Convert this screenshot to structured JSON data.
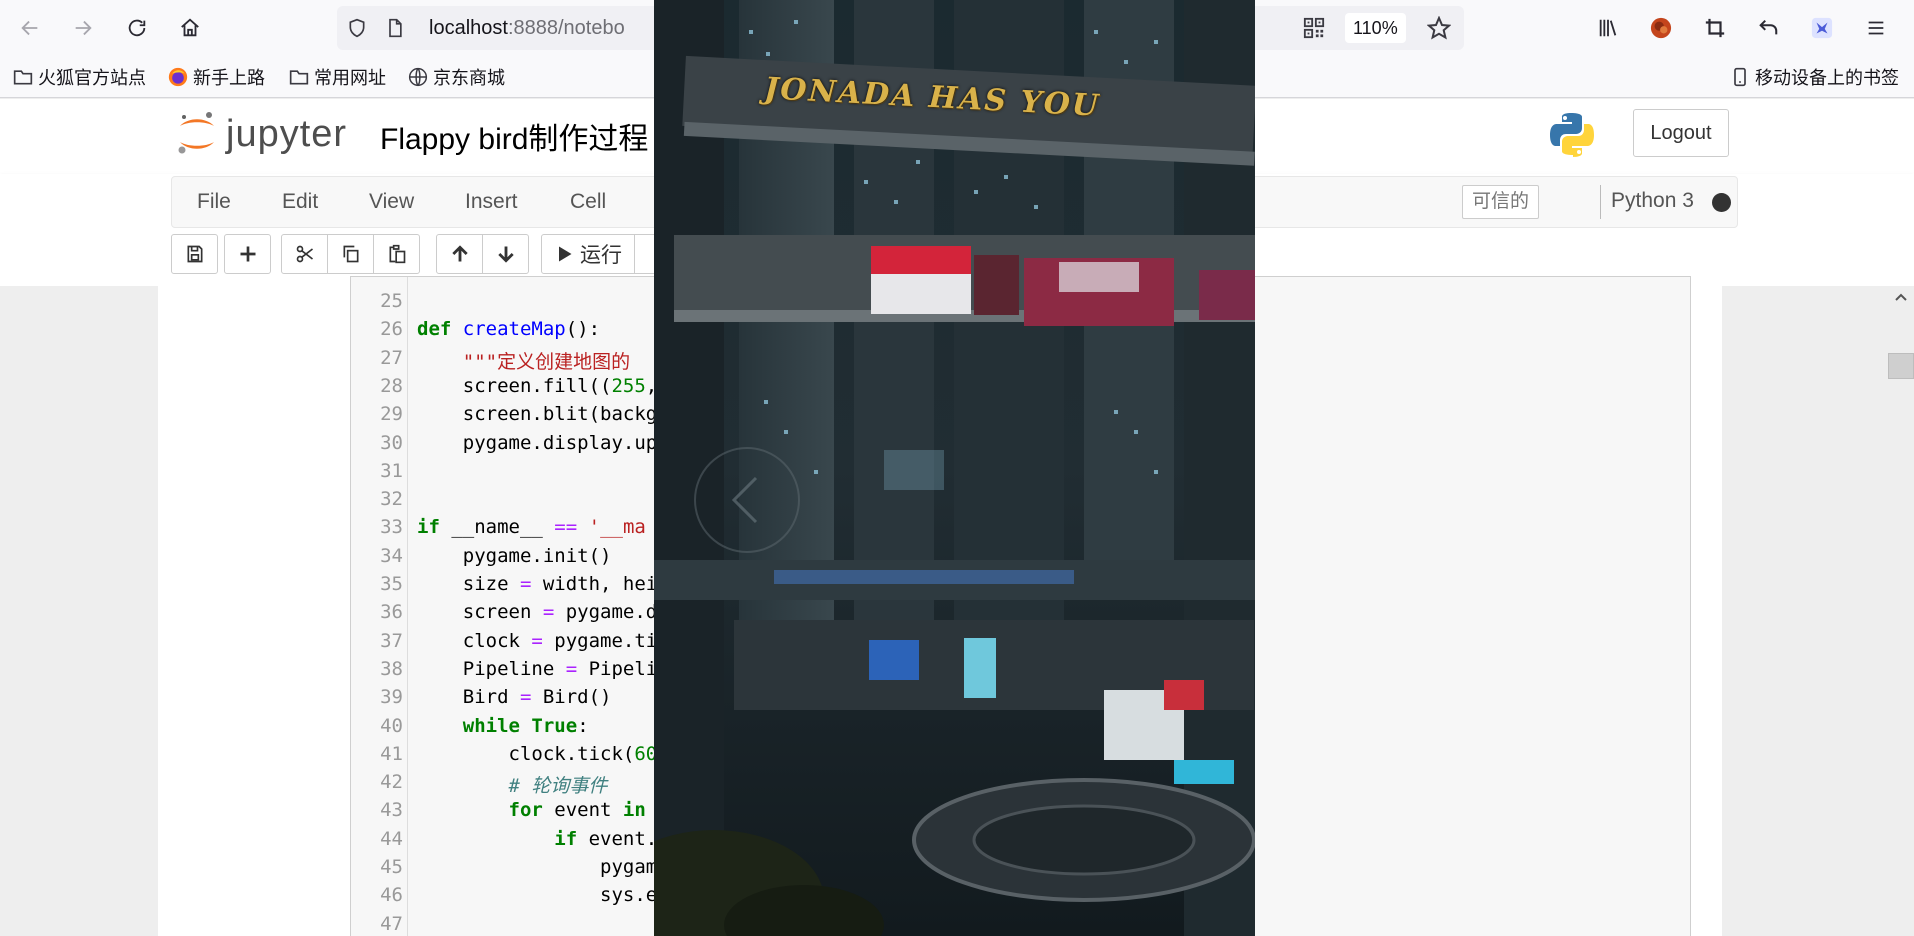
{
  "browser": {
    "url_host": "localhost",
    "url_path": ":8888/notebo",
    "zoom": "110%",
    "bookmarks": [
      {
        "label": "火狐官方站点",
        "icon": "folder-icon"
      },
      {
        "label": "新手上路",
        "icon": "firefox-icon"
      },
      {
        "label": "常用网址",
        "icon": "folder-icon"
      },
      {
        "label": "京东商城",
        "icon": "globe-icon"
      }
    ],
    "mobile_bookmarks": "移动设备上的书签"
  },
  "jupyter": {
    "logo_text": "jupyter",
    "notebook_title": "Flappy bird制作过程",
    "logout_label": "Logout",
    "menu": [
      "File",
      "Edit",
      "View",
      "Insert",
      "Cell"
    ],
    "trusted_label": "可信的",
    "kernel_name": "Python 3",
    "run_label": "运行"
  },
  "code_lines": [
    {
      "n": "25",
      "tokens": []
    },
    {
      "n": "26",
      "tokens": [
        {
          "t": "def",
          "c": "kw"
        },
        {
          "t": " "
        },
        {
          "t": "createMap",
          "c": "fn"
        },
        {
          "t": "():"
        }
      ]
    },
    {
      "n": "27",
      "tokens": [
        {
          "t": "    "
        },
        {
          "t": "\"\"\"定义创建地图的",
          "c": "str"
        }
      ]
    },
    {
      "n": "28",
      "tokens": [
        {
          "t": "    screen.fill(("
        },
        {
          "t": "255",
          "c": "num"
        },
        {
          "t": ","
        }
      ]
    },
    {
      "n": "29",
      "tokens": [
        {
          "t": "    screen.blit(backg"
        }
      ]
    },
    {
      "n": "30",
      "tokens": [
        {
          "t": "    pygame.display.up"
        }
      ]
    },
    {
      "n": "31",
      "tokens": []
    },
    {
      "n": "32",
      "tokens": []
    },
    {
      "n": "33",
      "tokens": [
        {
          "t": "if",
          "c": "kw"
        },
        {
          "t": " __name__ "
        },
        {
          "t": "==",
          "c": "op"
        },
        {
          "t": " "
        },
        {
          "t": "'__ma",
          "c": "str"
        }
      ]
    },
    {
      "n": "34",
      "tokens": [
        {
          "t": "    pygame.init()"
        }
      ]
    },
    {
      "n": "35",
      "tokens": [
        {
          "t": "    size "
        },
        {
          "t": "=",
          "c": "op"
        },
        {
          "t": " width, hei"
        }
      ]
    },
    {
      "n": "36",
      "tokens": [
        {
          "t": "    screen "
        },
        {
          "t": "=",
          "c": "op"
        },
        {
          "t": " pygame.d"
        }
      ]
    },
    {
      "n": "37",
      "tokens": [
        {
          "t": "    clock "
        },
        {
          "t": "=",
          "c": "op"
        },
        {
          "t": " pygame.ti"
        }
      ]
    },
    {
      "n": "38",
      "tokens": [
        {
          "t": "    Pipeline "
        },
        {
          "t": "=",
          "c": "op"
        },
        {
          "t": " Pipeli"
        }
      ]
    },
    {
      "n": "39",
      "tokens": [
        {
          "t": "    Bird "
        },
        {
          "t": "=",
          "c": "op"
        },
        {
          "t": " Bird()"
        }
      ]
    },
    {
      "n": "40",
      "tokens": [
        {
          "t": "    "
        },
        {
          "t": "while",
          "c": "kw"
        },
        {
          "t": " "
        },
        {
          "t": "True",
          "c": "kw"
        },
        {
          "t": ":"
        }
      ]
    },
    {
      "n": "41",
      "tokens": [
        {
          "t": "        clock.tick("
        },
        {
          "t": "60",
          "c": "num"
        }
      ]
    },
    {
      "n": "42",
      "tokens": [
        {
          "t": "        "
        },
        {
          "t": "# 轮询事件",
          "c": "cm"
        }
      ]
    },
    {
      "n": "43",
      "tokens": [
        {
          "t": "        "
        },
        {
          "t": "for",
          "c": "kw"
        },
        {
          "t": " event "
        },
        {
          "t": "in",
          "c": "kw"
        }
      ]
    },
    {
      "n": "44",
      "tokens": [
        {
          "t": "            "
        },
        {
          "t": "if",
          "c": "kw"
        },
        {
          "t": " event."
        }
      ]
    },
    {
      "n": "45",
      "tokens": [
        {
          "t": "                pygam"
        }
      ]
    },
    {
      "n": "46",
      "tokens": [
        {
          "t": "                sys.e"
        }
      ]
    },
    {
      "n": "47",
      "tokens": []
    }
  ],
  "game": {
    "sign_text": "JONADA HAS YOU"
  }
}
